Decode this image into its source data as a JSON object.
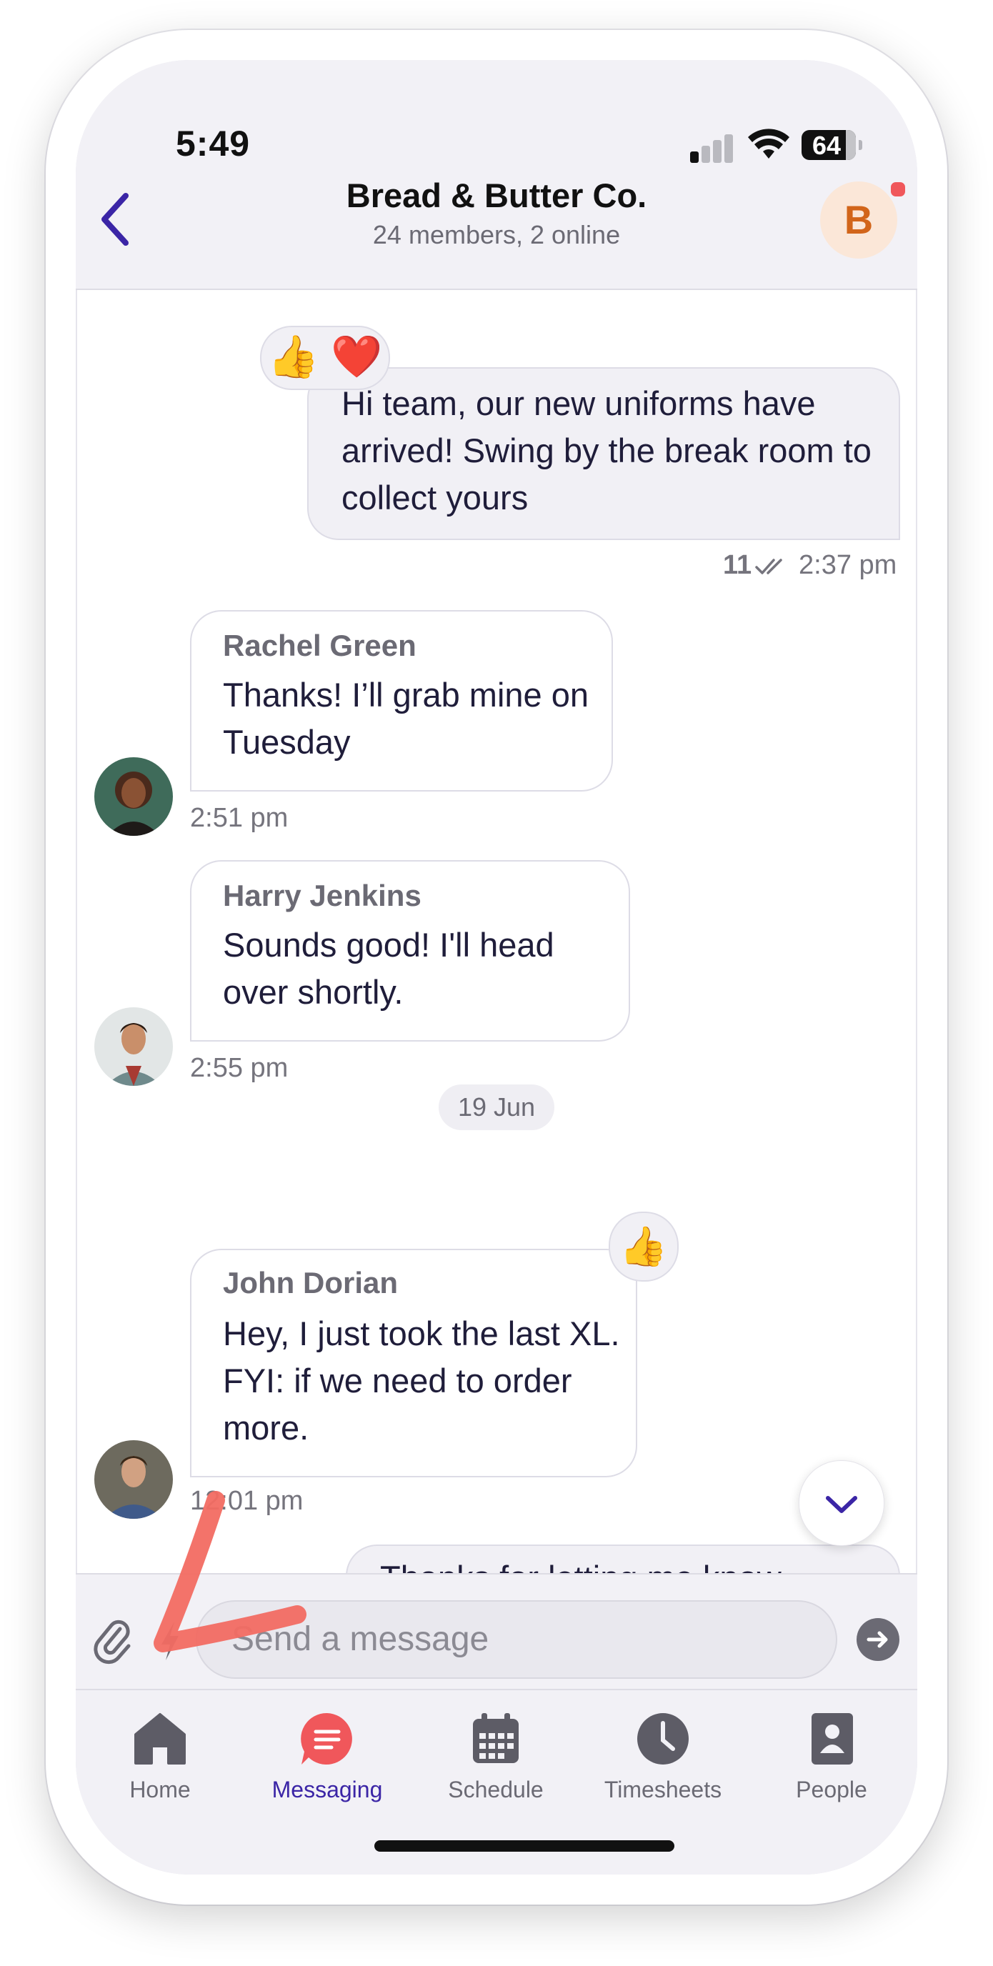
{
  "status": {
    "time": "5:49",
    "battery": "64"
  },
  "header": {
    "title": "Bread & Butter Co.",
    "subtitle": "24 members, 2 online",
    "avatar_letter": "B"
  },
  "messages": [
    {
      "type": "outgoing",
      "text": "Hi team, our new uniforms have arrived! Swing by the break room to collect yours",
      "reactions": "👍 ❤️",
      "read_count": "11",
      "time": "2:37 pm"
    },
    {
      "type": "incoming",
      "sender": "Rachel Green",
      "text": "Thanks! I’ll grab mine on Tuesday",
      "time": "2:51 pm"
    },
    {
      "type": "incoming",
      "sender": "Harry Jenkins",
      "text": "Sounds good! I'll head over shortly.",
      "time": "2:55 pm"
    },
    {
      "type": "incoming",
      "sender": "John Dorian",
      "text": "Hey, I just took the last XL. FYI: if we need to order more.",
      "reactions": "👍",
      "time": "12:01 pm"
    },
    {
      "type": "outgoing",
      "text": "Thanks for letting me know"
    }
  ],
  "date_divider": "19 Jun",
  "composer": {
    "placeholder": "Send a message"
  },
  "tabs": [
    {
      "label": "Home",
      "icon": "home-icon"
    },
    {
      "label": "Messaging",
      "icon": "chat-icon",
      "active": true
    },
    {
      "label": "Schedule",
      "icon": "calendar-icon"
    },
    {
      "label": "Timesheets",
      "icon": "clock-icon"
    },
    {
      "label": "People",
      "icon": "contacts-icon"
    }
  ],
  "colors": {
    "accent": "#3b25a6",
    "messaging_active": "#f0575b",
    "annotation": "#f26b62"
  }
}
